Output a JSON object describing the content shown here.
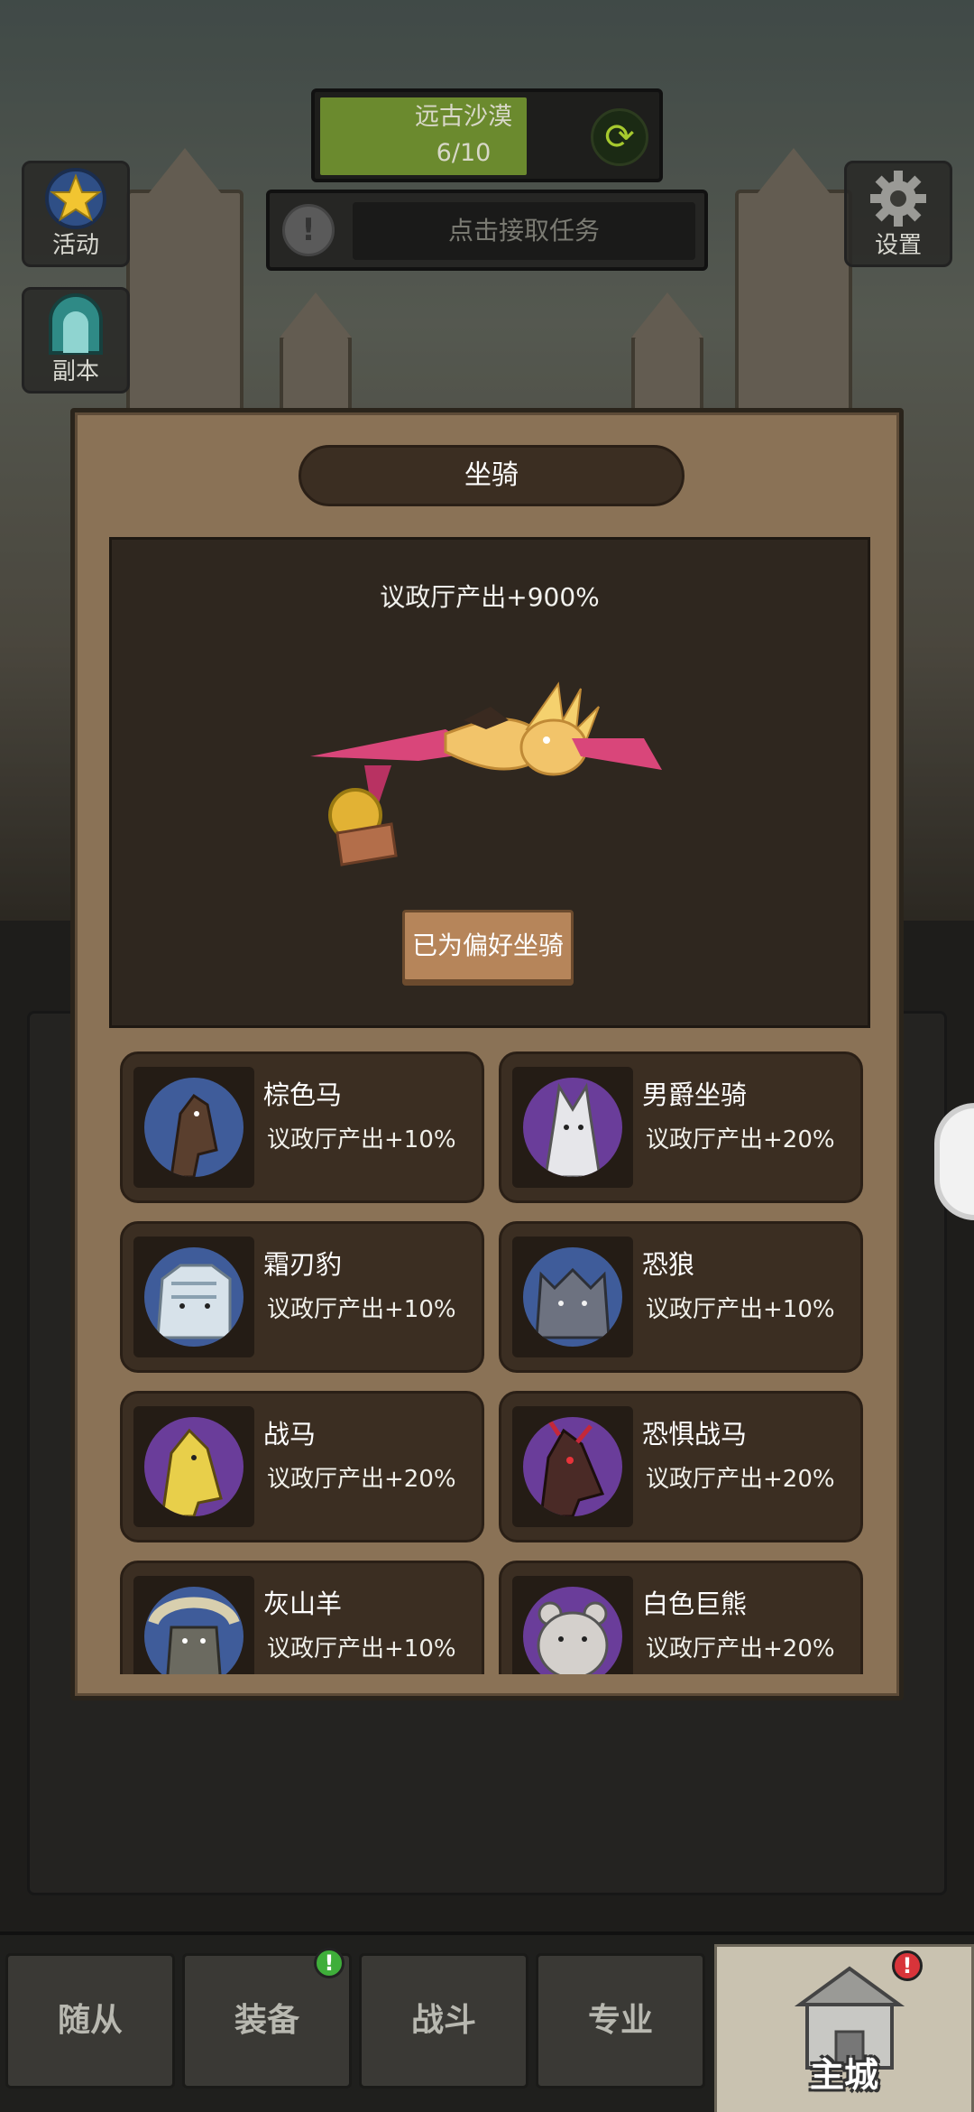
{
  "hud": {
    "area_name": "远古沙漠",
    "area_progress": "6/10",
    "area_progress_value": 0.6,
    "task_prompt": "点击接取任务"
  },
  "side_buttons": {
    "activity": "活动",
    "dungeon": "副本",
    "settings": "设置"
  },
  "mount_panel": {
    "title": "坐骑",
    "current_output": "议政厅产出+900%",
    "preferred_label": "已为偏好坐骑",
    "mounts": [
      {
        "name": "棕色马",
        "output": "议政厅产出+10%",
        "disc_color": "#3f5c9a"
      },
      {
        "name": "男爵坐骑",
        "output": "议政厅产出+20%",
        "disc_color": "#6a3d9a"
      },
      {
        "name": "霜刃豹",
        "output": "议政厅产出+10%",
        "disc_color": "#3f5c9a"
      },
      {
        "name": "恐狼",
        "output": "议政厅产出+10%",
        "disc_color": "#3f5c9a"
      },
      {
        "name": "战马",
        "output": "议政厅产出+20%",
        "disc_color": "#6a3d9a"
      },
      {
        "name": "恐惧战马",
        "output": "议政厅产出+20%",
        "disc_color": "#6a3d9a"
      },
      {
        "name": "灰山羊",
        "output": "议政厅产出+10%",
        "disc_color": "#3f5c9a"
      },
      {
        "name": "白色巨熊",
        "output": "议政厅产出+20%",
        "disc_color": "#6a3d9a"
      }
    ]
  },
  "bottom_nav": {
    "followers": "随从",
    "equipment": "装备",
    "battle": "战斗",
    "profession": "专业",
    "main_city": "主城"
  },
  "colors": {
    "panel": "#8a7256",
    "card": "#3b2e22",
    "progress": "#6b8a2e",
    "rare_disc": "#3f5c9a",
    "epic_disc": "#6a3d9a"
  }
}
